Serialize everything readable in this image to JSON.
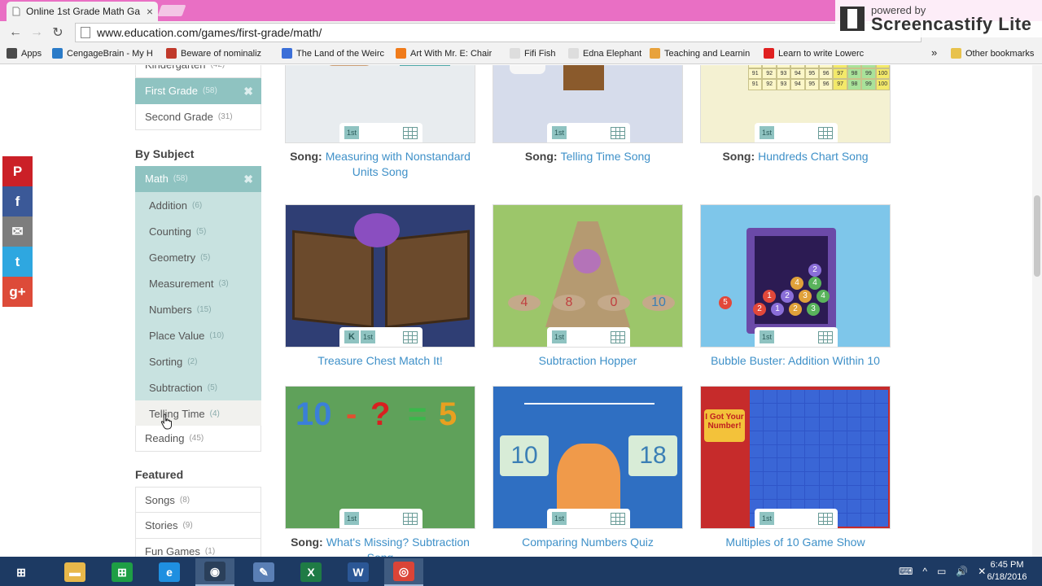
{
  "browser": {
    "tab": {
      "title": "Online 1st Grade Math Ga",
      "close": "×"
    },
    "nav": {
      "back": "←",
      "forward": "→",
      "reload": "↻"
    },
    "url": "www.education.com/games/first-grade/math/",
    "bookmarks": [
      {
        "label": "Apps",
        "icon_color": "#4a4a4a"
      },
      {
        "label": "CengageBrain - My H",
        "icon_color": "#2a7bc8"
      },
      {
        "label": "Beware of nominaliz",
        "icon_color": "#c0392b"
      },
      {
        "label": "The Land of the Weirc",
        "icon_color": "#3b6fd8"
      },
      {
        "label": "Art With Mr. E: Chair",
        "icon_color": "#f07b1a"
      },
      {
        "label": "Fifi Fish",
        "icon_color": "#dddddd"
      },
      {
        "label": "Edna Elephant",
        "icon_color": "#dddddd"
      },
      {
        "label": "Teaching and Learnin",
        "icon_color": "#e8a23c"
      },
      {
        "label": "Learn to write Lowerc",
        "icon_color": "#e02020"
      },
      {
        "label": "Other bookmarks",
        "icon_color": "#e8c24c"
      }
    ],
    "bookmarks_overflow": "»"
  },
  "screencastify": {
    "small": "powered by",
    "big": "Screencastify Lite"
  },
  "sidebar": {
    "grade_items": [
      {
        "label": "Kindergarten",
        "count": "(42)"
      },
      {
        "label": "First Grade",
        "count": "(58)",
        "remove": "✖"
      },
      {
        "label": "Second Grade",
        "count": "(31)"
      }
    ],
    "subject_heading": "By Subject",
    "subject": {
      "label": "Math",
      "count": "(58)",
      "remove": "✖"
    },
    "sub_items": [
      {
        "label": "Addition",
        "count": "(6)"
      },
      {
        "label": "Counting",
        "count": "(5)"
      },
      {
        "label": "Geometry",
        "count": "(5)"
      },
      {
        "label": "Measurement",
        "count": "(3)"
      },
      {
        "label": "Numbers",
        "count": "(15)"
      },
      {
        "label": "Place Value",
        "count": "(10)"
      },
      {
        "label": "Sorting",
        "count": "(2)"
      },
      {
        "label": "Subtraction",
        "count": "(5)"
      },
      {
        "label": "Telling Time",
        "count": "(4)"
      }
    ],
    "reading": {
      "label": "Reading",
      "count": "(45)"
    },
    "featured_heading": "Featured",
    "featured_items": [
      {
        "label": "Songs",
        "count": "(8)"
      },
      {
        "label": "Stories",
        "count": "(9)"
      },
      {
        "label": "Fun Games",
        "count": "(1)"
      }
    ]
  },
  "social": [
    {
      "name": "pinterest",
      "glyph": "P",
      "color": "#cb2027"
    },
    {
      "name": "facebook",
      "glyph": "f",
      "color": "#3b5998"
    },
    {
      "name": "email",
      "glyph": "✉",
      "color": "#7d7d7d"
    },
    {
      "name": "twitter",
      "glyph": "t",
      "color": "#2ea7e0"
    },
    {
      "name": "google-plus",
      "glyph": "g+",
      "color": "#dd4b39"
    }
  ],
  "cards": [
    {
      "prefix": "Song:",
      "title": "Measuring with Nonstandard Units Song",
      "grades": [
        "1st"
      ],
      "bg": "#e8ecef"
    },
    {
      "prefix": "Song:",
      "title": "Telling Time Song",
      "grades": [
        "1st"
      ],
      "bg": "#d6dceb"
    },
    {
      "prefix": "Song:",
      "title": "Hundreds Chart Song",
      "grades": [
        "1st"
      ],
      "bg": "#f4f1d2"
    },
    {
      "prefix": "",
      "title": "Treasure Chest Match It!",
      "grades": [
        "K",
        "1st"
      ],
      "bg": "#2f3e74"
    },
    {
      "prefix": "",
      "title": "Subtraction Hopper",
      "grades": [
        "1st"
      ],
      "bg": "#9cc66a"
    },
    {
      "prefix": "",
      "title": "Bubble Buster: Addition Within 10",
      "grades": [
        "1st"
      ],
      "bg": "#7ec6ea"
    },
    {
      "prefix": "Song:",
      "title": "What's Missing? Subtraction Song",
      "grades": [
        "1st"
      ],
      "bg": "#5fa15a"
    },
    {
      "prefix": "",
      "title": "Comparing Numbers Quiz",
      "grades": [
        "1st"
      ],
      "bg": "#2f6fc2"
    },
    {
      "prefix": "",
      "title": "Multiples of 10 Game Show",
      "grades": [
        "1st"
      ],
      "bg": "#c62b2b"
    }
  ],
  "card_art": {
    "hopper_numbers": [
      "4",
      "8",
      "0",
      "10"
    ],
    "missing_eq": [
      "10",
      "-",
      "?",
      "=",
      "5"
    ],
    "compare_numbers": [
      "10",
      "18"
    ],
    "bubble_numbers": [
      "2",
      "4",
      "4",
      "1",
      "2",
      "3",
      "4",
      "2",
      "1",
      "2",
      "3",
      "5"
    ],
    "hundreds_values": [
      "91",
      "92",
      "93",
      "94",
      "95",
      "96",
      "97",
      "98",
      "99",
      "100"
    ],
    "game_show_sign": "I Got Your Number!"
  },
  "taskbar": {
    "apps": [
      {
        "name": "start",
        "glyph": "⊞",
        "color": "#1d3a63"
      },
      {
        "name": "file-explorer",
        "glyph": "▬",
        "color": "#e8b84a"
      },
      {
        "name": "store",
        "glyph": "⊞",
        "color": "#1e9e45"
      },
      {
        "name": "internet-explorer",
        "glyph": "e",
        "color": "#1f8fe0"
      },
      {
        "name": "steam",
        "glyph": "◉",
        "color": "#2a3f5a"
      },
      {
        "name": "paint",
        "glyph": "✎",
        "color": "#5a7fb5"
      },
      {
        "name": "excel",
        "glyph": "X",
        "color": "#1f7b45"
      },
      {
        "name": "word",
        "glyph": "W",
        "color": "#2b5796"
      },
      {
        "name": "chrome",
        "glyph": "◎",
        "color": "#db4437"
      }
    ],
    "tray_glyphs": [
      "⌨",
      "^",
      "▭",
      "🔊",
      "✕"
    ],
    "time": "6:45 PM",
    "date": "6/18/2016"
  }
}
